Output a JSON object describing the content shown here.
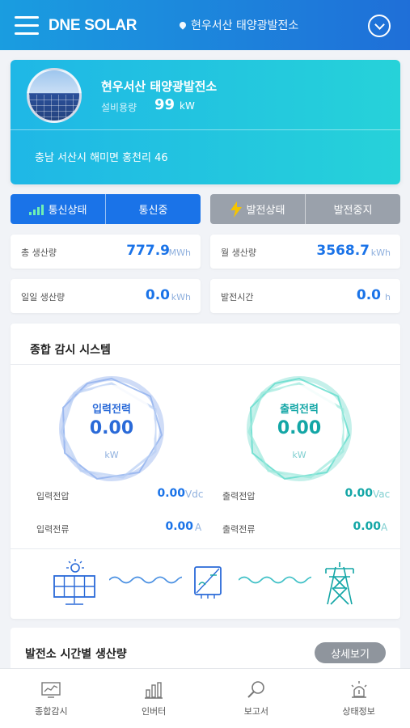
{
  "header": {
    "brand": "DNE SOLAR",
    "location": "현우서산 태양광발전소"
  },
  "plant": {
    "name": "현우서산 태양광발전소",
    "capacity_label": "설비용량",
    "capacity_value": "99",
    "capacity_unit": "kW",
    "address": "충남 서산시 해미면 홍천리 46"
  },
  "status": {
    "comm_label": "통신상태",
    "comm_value": "통신중",
    "gen_label": "발전상태",
    "gen_value": "발전중지"
  },
  "stats": {
    "total": {
      "label": "총 생산량",
      "value": "777.9",
      "unit": "MWh"
    },
    "monthly": {
      "label": "월 생산량",
      "value": "3568.7",
      "unit": "kWh"
    },
    "daily": {
      "label": "일일 생산량",
      "value": "0.0",
      "unit": "kWh"
    },
    "gen_time": {
      "label": "발전시간",
      "value": "0.0",
      "unit": "h"
    }
  },
  "monitor": {
    "title": "종합 감시 시스템",
    "input": {
      "label": "입력전력",
      "value": "0.00",
      "unit": "kW"
    },
    "output": {
      "label": "출력전력",
      "value": "0.00",
      "unit": "kW"
    },
    "input_voltage": {
      "label": "입력전압",
      "value": "0.00",
      "unit": "Vdc"
    },
    "input_current": {
      "label": "입력전류",
      "value": "0.00",
      "unit": "A"
    },
    "output_voltage": {
      "label": "출력전압",
      "value": "0.00",
      "unit": "Vac"
    },
    "output_current": {
      "label": "출력전류",
      "value": "0.00",
      "unit": "A"
    }
  },
  "hourly": {
    "title": "발전소 시간별 생산량",
    "detail_button": "상세보기"
  },
  "nav": {
    "items": [
      {
        "label": "종합감시",
        "icon": "monitor-chart-icon"
      },
      {
        "label": "인버터",
        "icon": "bar-chart-icon"
      },
      {
        "label": "보고서",
        "icon": "search-icon"
      },
      {
        "label": "상태정보",
        "icon": "alarm-light-icon"
      }
    ]
  },
  "colors": {
    "header_start": "#1a9de0",
    "header_end": "#1f6fd8",
    "accent_blue": "#1a73e8",
    "accent_teal": "#13a6a6",
    "status_gray": "#9aa1ab"
  }
}
